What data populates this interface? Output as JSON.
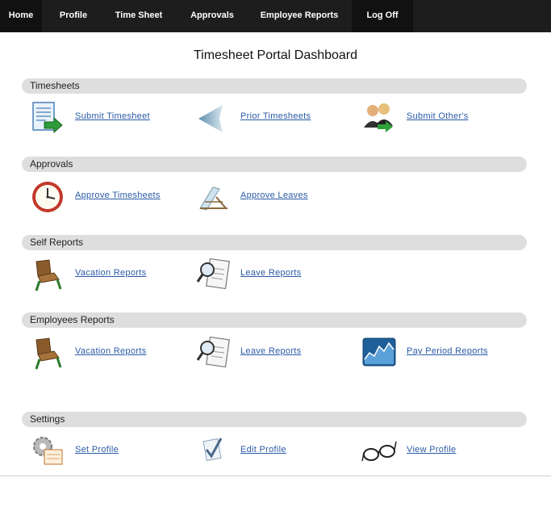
{
  "nav": {
    "items": [
      {
        "label": "Home"
      },
      {
        "label": "Profile"
      },
      {
        "label": "Time Sheet"
      },
      {
        "label": "Approvals"
      },
      {
        "label": "Employee Reports"
      },
      {
        "label": "Log Off"
      }
    ]
  },
  "page_title": "Timesheet Portal Dashboard",
  "sections": {
    "timesheets": {
      "title": "Timesheets",
      "links": [
        {
          "label": "Submit Timesheet",
          "icon": "submit-timesheet-icon"
        },
        {
          "label": "Prior Timesheets",
          "icon": "back-arrow-icon"
        },
        {
          "label": "Submit Other's",
          "icon": "users-icon"
        }
      ]
    },
    "approvals": {
      "title": "Approvals",
      "links": [
        {
          "label": "Approve Timesheets",
          "icon": "clock-icon"
        },
        {
          "label": "Approve Leaves",
          "icon": "beach-chair-icon"
        }
      ]
    },
    "self_reports": {
      "title": "Self Reports",
      "links": [
        {
          "label": "Vacation Reports",
          "icon": "chair-icon"
        },
        {
          "label": "Leave Reports",
          "icon": "magnifier-document-icon"
        }
      ]
    },
    "employees_reports": {
      "title": "Employees Reports",
      "links": [
        {
          "label": "Vacation Reports",
          "icon": "chair-icon"
        },
        {
          "label": "Leave Reports",
          "icon": "magnifier-document-icon"
        },
        {
          "label": "Pay Period Reports",
          "icon": "chart-icon"
        }
      ]
    },
    "settings": {
      "title": "Settings",
      "links": [
        {
          "label": "Set Profile",
          "icon": "gear-document-icon"
        },
        {
          "label": "Edit Profile",
          "icon": "edit-check-icon"
        },
        {
          "label": "View Profile",
          "icon": "glasses-icon"
        }
      ]
    }
  },
  "colors": {
    "nav_background": "#1d1d1d",
    "section_bar": "#dedede",
    "link": "#2b5aa6"
  }
}
